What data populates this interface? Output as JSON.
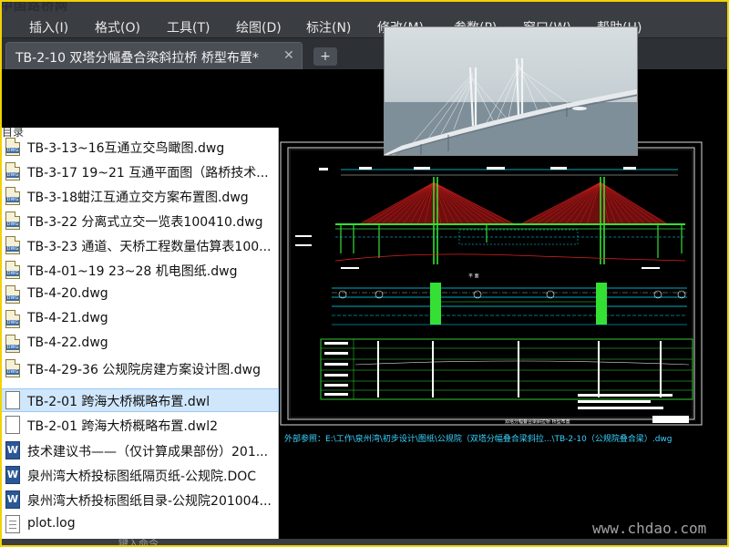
{
  "menu": {
    "logo_text": "中国路桥网",
    "items": [
      "插入(I)",
      "格式(O)",
      "工具(T)",
      "绘图(D)",
      "标注(N)",
      "修改(M)",
      "参数(P)",
      "窗口(W)",
      "帮助(H)"
    ]
  },
  "tab": {
    "title": "TB-2-10 双塔分幅叠合梁斜拉桥 桥型布置*",
    "close_glyph": "✕",
    "new_glyph": "+"
  },
  "file_panel": {
    "header": "目录",
    "files": [
      {
        "name": "TB-3-13~16互通立交鸟瞰图.dwg",
        "icon": "dwg-icon"
      },
      {
        "name": "TB-3-17 19~21 互通平面图（路桥技术...",
        "icon": "dwg-icon"
      },
      {
        "name": "TB-3-18蚶江互通立交方案布置图.dwg",
        "icon": "dwg-icon"
      },
      {
        "name": "TB-3-22 分离式立交一览表100410.dwg",
        "icon": "dwg-icon"
      },
      {
        "name": "TB-3-23 通道、天桥工程数量估算表100...",
        "icon": "dwg-icon"
      },
      {
        "name": "TB-4-01~19 23~28 机电图纸.dwg",
        "icon": "dwg-icon"
      },
      {
        "name": "TB-4-20.dwg",
        "icon": "dwg-icon"
      },
      {
        "name": "TB-4-21.dwg",
        "icon": "dwg-icon"
      },
      {
        "name": "TB-4-22.dwg",
        "icon": "dwg-icon"
      },
      {
        "name": "TB-4-29-36 公规院房建方案设计图.dwg",
        "icon": "dwg-icon"
      },
      {
        "name": "TB-2-01 跨海大桥概略布置.dwl",
        "icon": "dwl-icon",
        "selected": true
      },
      {
        "name": "TB-2-01 跨海大桥概略布置.dwl2",
        "icon": "dwl-icon"
      },
      {
        "name": "技术建议书——（仅计算成果部份）201...",
        "icon": "doc-icon"
      },
      {
        "name": "泉州湾大桥投标图纸隔页纸-公规院.DOC",
        "icon": "doc-icon"
      },
      {
        "name": "泉州湾大桥投标图纸目录-公规院201004...",
        "icon": "doc-icon"
      },
      {
        "name": "plot.log",
        "icon": "log-icon"
      }
    ]
  },
  "drawing": {
    "sheet_title": "双塔分幅叠合梁斜拉桥 桥型布置",
    "file_path": "外部参照：E:\\工作\\泉州湾\\初步设计\\图纸\\公规院（双塔分幅叠合梁斜拉...\\TB-2-10（公规院叠合梁）.dwg"
  },
  "command": {
    "prompt": "键入命令"
  },
  "watermark": "www.chdao.com",
  "colors": {
    "menubar": "#3a3d42",
    "selection": "#cfe6fb",
    "cad_cyan": "#00e5ff",
    "cad_green": "#35e035",
    "cad_red": "#e02020",
    "cad_yellow": "#f5f500",
    "frame_border": "#f1d300"
  }
}
